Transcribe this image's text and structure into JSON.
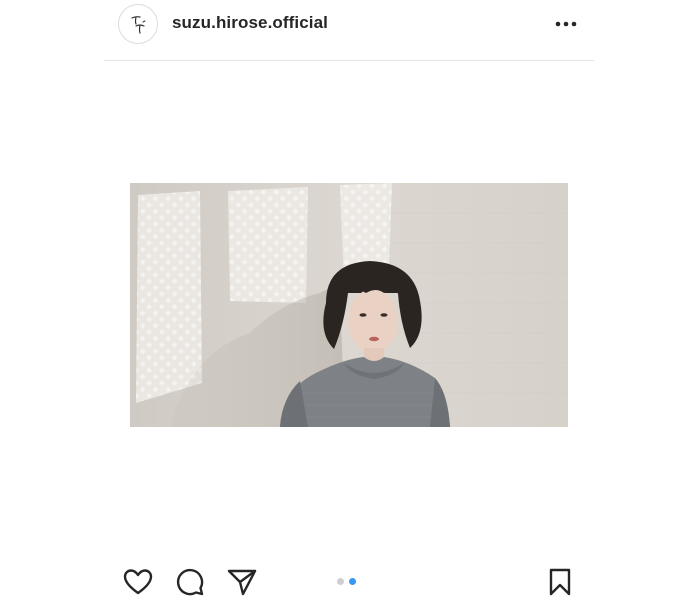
{
  "post": {
    "username": "suzu.hirose.official",
    "avatar_icon": "signature-logo-icon",
    "more_icon": "more-options-icon"
  },
  "media": {
    "type": "photo",
    "carousel": {
      "total": 2,
      "current": 2,
      "active_color": "#3897f0",
      "inactive_color": "#cfcfcf"
    }
  },
  "actions": {
    "like_icon": "heart-icon",
    "comment_icon": "comment-icon",
    "share_icon": "paper-plane-icon",
    "save_icon": "bookmark-icon"
  },
  "colors": {
    "text": "#262626",
    "divider": "#e6e6e6",
    "background": "#ffffff"
  }
}
